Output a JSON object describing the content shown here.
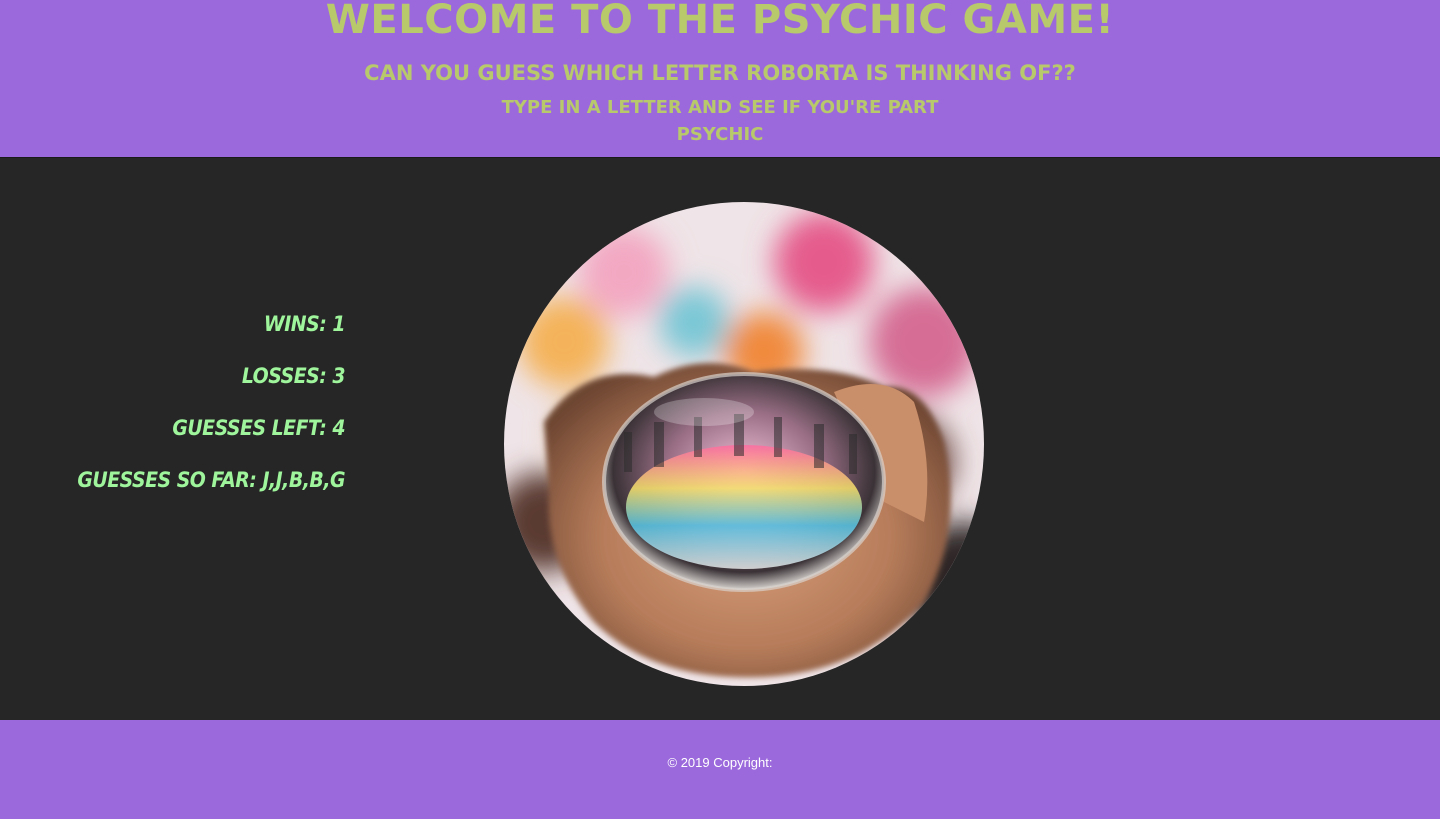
{
  "header": {
    "title": "Welcome to the Psychic Game!",
    "subtitle": "Can you guess which letter Roborta is thinking of??",
    "instructions": "Type in a letter and see if you're part psychic"
  },
  "stats": {
    "wins_label": "Wins: 1",
    "losses_label": "Losses: 3",
    "guesses_left_label": "Guesses Left: 4",
    "guesses_so_far_label": "Guesses so far: J,J,B,B,G"
  },
  "image": {
    "subject": "hand holding crystal ball"
  },
  "footer": {
    "copyright": "© 2019 Copyright:"
  },
  "colors": {
    "header_bg": "#9b69dc",
    "body_bg": "#262626",
    "heading_text": "#b8c96b",
    "stats_text": "#9ef59b",
    "footer_text": "#ffffff"
  }
}
